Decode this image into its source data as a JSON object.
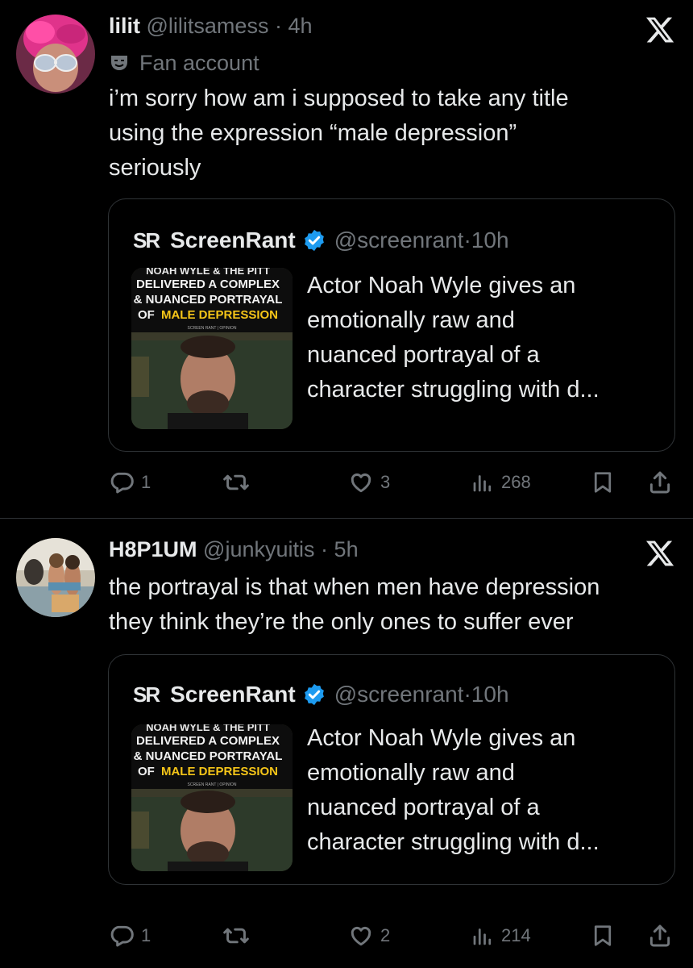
{
  "tweets": [
    {
      "display_name": "lilit",
      "handle": "@lilitsamess",
      "dot": "·",
      "time": "4h",
      "label_text": "Fan account",
      "text_lines": [
        "i’m sorry how am i supposed to take any title",
        "using the expression “male depression”",
        "seriously"
      ],
      "quote": {
        "logo": "SR",
        "name": "ScreenRant",
        "handle": "@screenrant",
        "dot": "·",
        "time": "10h",
        "thumb_lines": [
          "NOAH WYLE & THE PITT",
          "DELIVERED A COMPLEX",
          "& NUANCED PORTRAYAL",
          "OF",
          "MALE DEPRESSION",
          "SCREEN RANT | OPINION"
        ],
        "text_lines": [
          "Actor Noah Wyle gives an",
          "emotionally raw and",
          "nuanced portrayal of a",
          "character struggling with d..."
        ]
      },
      "replies": "1",
      "likes": "3",
      "views": "268"
    },
    {
      "display_name": "H8P1UM",
      "handle": "@junkyuitis",
      "dot": "·",
      "time": "5h",
      "text_lines": [
        "the portrayal is that when men have depression",
        "they think they’re the only ones to suffer ever"
      ],
      "quote": {
        "logo": "SR",
        "name": "ScreenRant",
        "handle": "@screenrant",
        "dot": "·",
        "time": "10h",
        "thumb_lines": [
          "NOAH WYLE & THE PITT",
          "DELIVERED A COMPLEX",
          "& NUANCED PORTRAYAL",
          "OF",
          "MALE DEPRESSION",
          "SCREEN RANT | OPINION"
        ],
        "text_lines": [
          "Actor Noah Wyle gives an",
          "emotionally raw and",
          "nuanced portrayal of a",
          "character struggling with d..."
        ]
      },
      "replies": "1",
      "likes": "2",
      "views": "214"
    }
  ],
  "icons": {
    "x_logo": "x-logo-icon",
    "label": "theater-mask-icon",
    "verified": "verified-badge-icon",
    "reply": "reply-icon",
    "retweet": "retweet-icon",
    "like": "heart-icon",
    "views": "views-icon",
    "bookmark": "bookmark-icon",
    "share": "share-icon"
  },
  "colors": {
    "background": "#000000",
    "text": "#e7e9ea",
    "muted": "#71767b",
    "border": "#2f3336",
    "verified": "#1d9bf0",
    "thumb_yellow": "#f5c518"
  }
}
